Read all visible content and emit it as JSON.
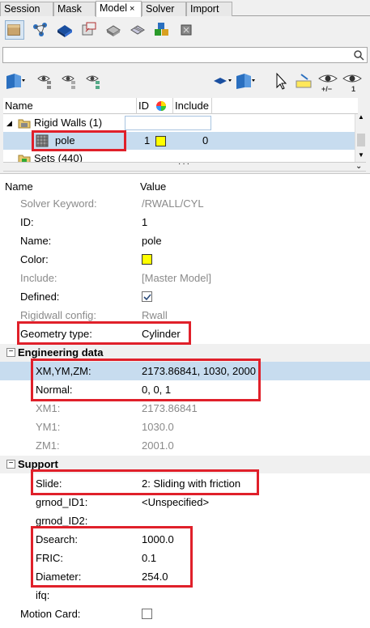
{
  "tabs": [
    {
      "label": "Session"
    },
    {
      "label": "Mask"
    },
    {
      "label": "Model",
      "close": "×"
    },
    {
      "label": "Solver"
    },
    {
      "label": "Import"
    }
  ],
  "tree": {
    "headers": {
      "name": "Name",
      "id": "ID",
      "include": "Include"
    },
    "rows": [
      {
        "label": "Rigid Walls (1)"
      },
      {
        "label": "pole",
        "id": "1",
        "include": "0"
      },
      {
        "label": "Sets (440)"
      }
    ]
  },
  "props": {
    "headers": {
      "name": "Name",
      "value": "Value"
    },
    "rows": {
      "solver_keyword": {
        "name": "Solver Keyword:",
        "value": "/RWALL/CYL"
      },
      "id": {
        "name": "ID:",
        "value": "1"
      },
      "name": {
        "name": "Name:",
        "value": "pole"
      },
      "color": {
        "name": "Color:"
      },
      "include": {
        "name": "Include:",
        "value": "[Master Model]"
      },
      "defined": {
        "name": "Defined:"
      },
      "rigidwall_config": {
        "name": "Rigidwall config:",
        "value": "Rwall"
      },
      "geometry_type": {
        "name": "Geometry type:",
        "value": "Cylinder"
      },
      "xm": {
        "name": "XM,YM,ZM:",
        "value": "2173.86841, 1030, 2000"
      },
      "normal": {
        "name": "Normal:",
        "value": "0, 0, 1"
      },
      "xm1": {
        "name": "XM1:",
        "value": "2173.86841"
      },
      "ym1": {
        "name": "YM1:",
        "value": "1030.0"
      },
      "zm1": {
        "name": "ZM1:",
        "value": "2001.0"
      },
      "slide": {
        "name": "Slide:",
        "value": "2: Sliding with friction"
      },
      "grnod1": {
        "name": "grnod_ID1:",
        "value": "<Unspecified>"
      },
      "grnod2": {
        "name": "grnod_ID2:"
      },
      "dsearch": {
        "name": "Dsearch:",
        "value": "1000.0"
      },
      "fric": {
        "name": "FRIC:",
        "value": "0.1"
      },
      "diameter": {
        "name": "Diameter:",
        "value": "254.0"
      },
      "ifq": {
        "name": "ifq:"
      },
      "motion_card": {
        "name": "Motion Card:"
      }
    },
    "sections": {
      "engineering": {
        "label": "Engineering data",
        "toggle": "−"
      },
      "support": {
        "label": "Support",
        "toggle": "−"
      }
    }
  },
  "toolbar2": {
    "plus_minus": "+/−",
    "one": "1"
  },
  "colors": {
    "highlight": "#c7dcef",
    "callout": "#e0202a",
    "swatch": "#ffff00"
  }
}
